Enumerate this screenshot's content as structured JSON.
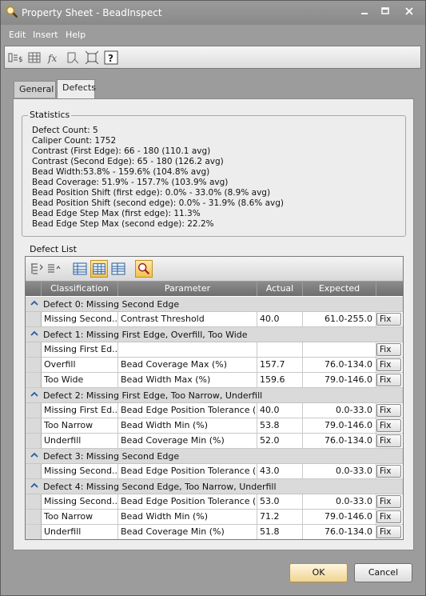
{
  "window": {
    "title": "Property Sheet - BeadInspect"
  },
  "menu": [
    "Edit",
    "Insert",
    "Help"
  ],
  "tabs": [
    {
      "label": "General"
    },
    {
      "label": "Defects"
    }
  ],
  "statistics": {
    "legend": "Statistics",
    "lines": [
      "Defect Count: 5",
      "Caliper Count: 1752",
      "Contrast (First Edge): 66 - 180 (110.1 avg)",
      "Contrast (Second Edge): 65 - 180 (126.2 avg)",
      "Bead Width:53.8% - 159.6% (104.8% avg)",
      "Bead Coverage: 51.9% - 157.7% (103.9% avg)",
      "Bead Position Shift (first edge): 0.0% - 33.0% (8.9% avg)",
      "Bead Position Shift (second edge): 0.0% - 31.9% (8.6% avg)",
      "Bead Edge Step Max (first edge): 11.3%",
      "Bead Edge Step Max (second edge): 22.2%"
    ]
  },
  "defect_list": {
    "label": "Defect List",
    "columns": [
      "Classification",
      "Parameter",
      "Actual",
      "Expected"
    ],
    "fix_label": "Fix",
    "groups": [
      {
        "title": "Defect  0: Missing Second Edge",
        "rows": [
          {
            "classification": "Missing Second...",
            "parameter": "Contrast Threshold",
            "actual": "40.0",
            "expected": "61.0-255.0"
          }
        ]
      },
      {
        "title": "Defect  1: Missing First Edge, Overfill, Too Wide",
        "rows": [
          {
            "classification": "Missing First Ed...",
            "parameter": "",
            "actual": "",
            "expected": ""
          },
          {
            "classification": "Overfill",
            "parameter": "Bead Coverage Max (%)",
            "actual": "157.7",
            "expected": "76.0-134.0"
          },
          {
            "classification": "Too Wide",
            "parameter": "Bead Width Max (%)",
            "actual": "159.6",
            "expected": "79.0-146.0"
          }
        ]
      },
      {
        "title": "Defect  2: Missing First Edge, Too Narrow, Underfill",
        "rows": [
          {
            "classification": "Missing First Ed...",
            "parameter": "Bead Edge Position Tolerance (...",
            "actual": "40.0",
            "expected": "0.0-33.0"
          },
          {
            "classification": "Too Narrow",
            "parameter": "Bead Width Min (%)",
            "actual": "53.8",
            "expected": "79.0-146.0"
          },
          {
            "classification": "Underfill",
            "parameter": "Bead Coverage Min (%)",
            "actual": "52.0",
            "expected": "76.0-134.0"
          }
        ]
      },
      {
        "title": "Defect  3: Missing Second Edge",
        "rows": [
          {
            "classification": "Missing Second...",
            "parameter": "Bead Edge Position Tolerance (...",
            "actual": "43.0",
            "expected": "0.0-33.0"
          }
        ]
      },
      {
        "title": "Defect  4: Missing Second Edge, Too Narrow, Underfill",
        "rows": [
          {
            "classification": "Missing Second...",
            "parameter": "Bead Edge Position Tolerance (...",
            "actual": "53.0",
            "expected": "0.0-33.0"
          },
          {
            "classification": "Too Narrow",
            "parameter": "Bead Width Min (%)",
            "actual": "71.2",
            "expected": "79.0-146.0"
          },
          {
            "classification": "Underfill",
            "parameter": "Bead Coverage Min (%)",
            "actual": "51.8",
            "expected": "76.0-134.0"
          }
        ]
      }
    ]
  },
  "buttons": {
    "ok": "OK",
    "cancel": "Cancel"
  },
  "icons": {
    "toolbar": [
      "field-list-icon",
      "grid-icon",
      "function-icon",
      "shape-icon",
      "expand-icon",
      "help-icon"
    ],
    "defect_toolbar": [
      "sort-tree-icon",
      "sort-list-icon",
      "view-details-icon",
      "view-grid-icon",
      "view-table-icon",
      "inspect-icon"
    ]
  }
}
